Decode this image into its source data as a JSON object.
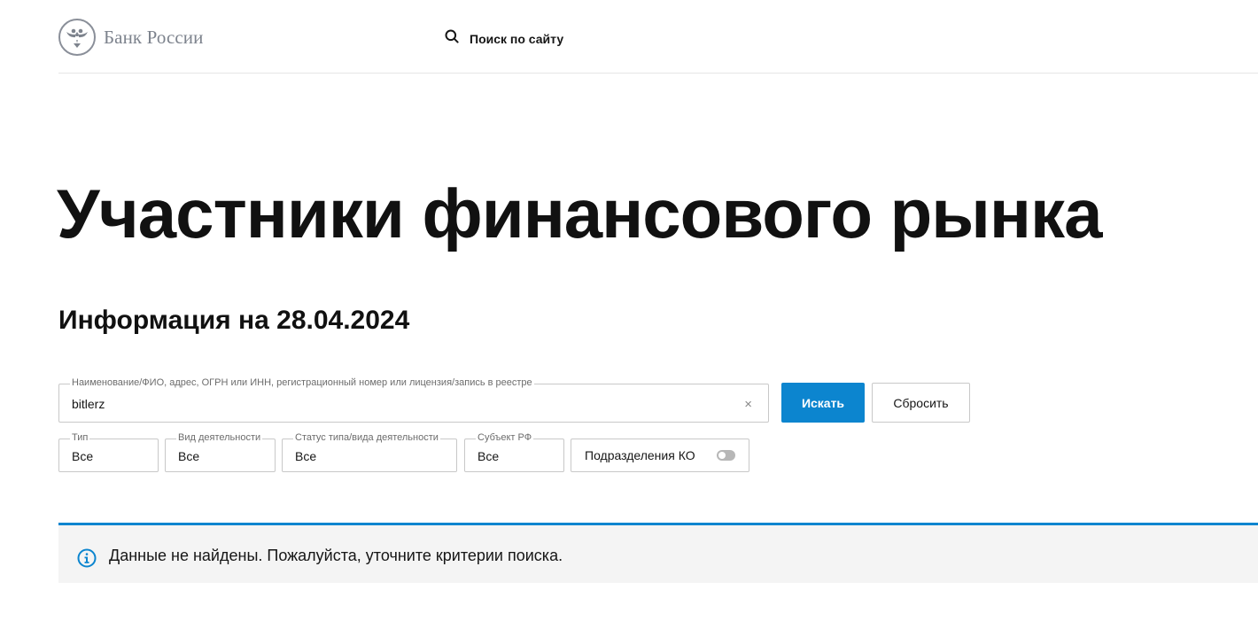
{
  "header": {
    "logo_text": "Банк России",
    "search_label": "Поиск по сайту"
  },
  "page": {
    "title": "Участники финансового рынка",
    "subtitle": "Информация на 28.04.2024"
  },
  "search": {
    "label": "Наименование/ФИО, адрес, ОГРН или ИНН, регистрационный номер или лицензия/запись в реестре",
    "value": "bitlerz",
    "clear": "×",
    "submit_label": "Искать",
    "reset_label": "Сбросить"
  },
  "filters": {
    "type": {
      "label": "Тип",
      "value": "Все"
    },
    "activity": {
      "label": "Вид деятельности",
      "value": "Все"
    },
    "status": {
      "label": "Статус типа/вида деятельности",
      "value": "Все"
    },
    "region": {
      "label": "Субъект РФ",
      "value": "Все"
    },
    "branches": {
      "label": "Подразделения КО",
      "enabled": false
    }
  },
  "notice": {
    "message": "Данные не найдены. Пожалуйста, уточните критерии поиска."
  },
  "colors": {
    "accent": "#0c85cf",
    "notice_bg": "#f4f4f4",
    "logo_gray": "#7d838d"
  },
  "icons": [
    "bank-emblem-icon",
    "search-icon",
    "close-icon",
    "info-icon"
  ]
}
